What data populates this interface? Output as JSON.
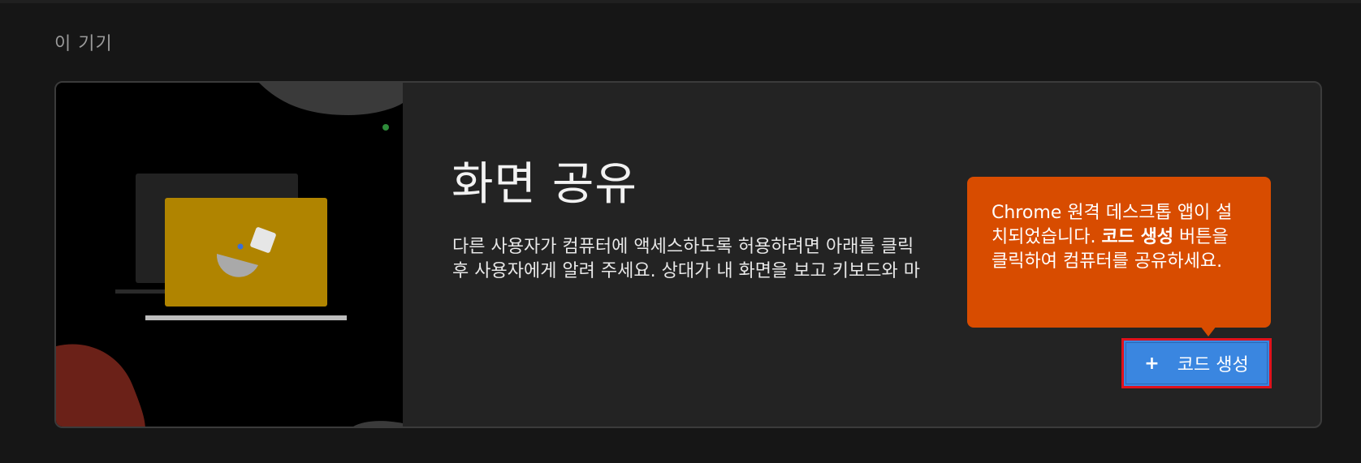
{
  "section": {
    "label": "이 기기"
  },
  "card": {
    "title": "화면 공유",
    "description_lines": [
      "다른 사용자가 컴퓨터에 액세스하도록 허용하려면 아래를 클릭",
      "후 사용자에게 알려 주세요. 상대가 내 화면을 보고 키보드와 마"
    ]
  },
  "tooltip": {
    "part1": "Chrome 원격 데스크톱 앱이 설치되었습니다. ",
    "bold": "코드 생성",
    "part2": " 버튼을 클릭하여 컴퓨터를 공유하세요."
  },
  "generate_button": {
    "plus": "+",
    "label": "코드 생성"
  },
  "colors": {
    "tooltip_bg": "#d84c00",
    "button_bg": "#3a86e0",
    "highlight_border": "#e0111c",
    "laptop_screen": "#b08400"
  },
  "icons": {
    "plus": "plus-icon"
  }
}
